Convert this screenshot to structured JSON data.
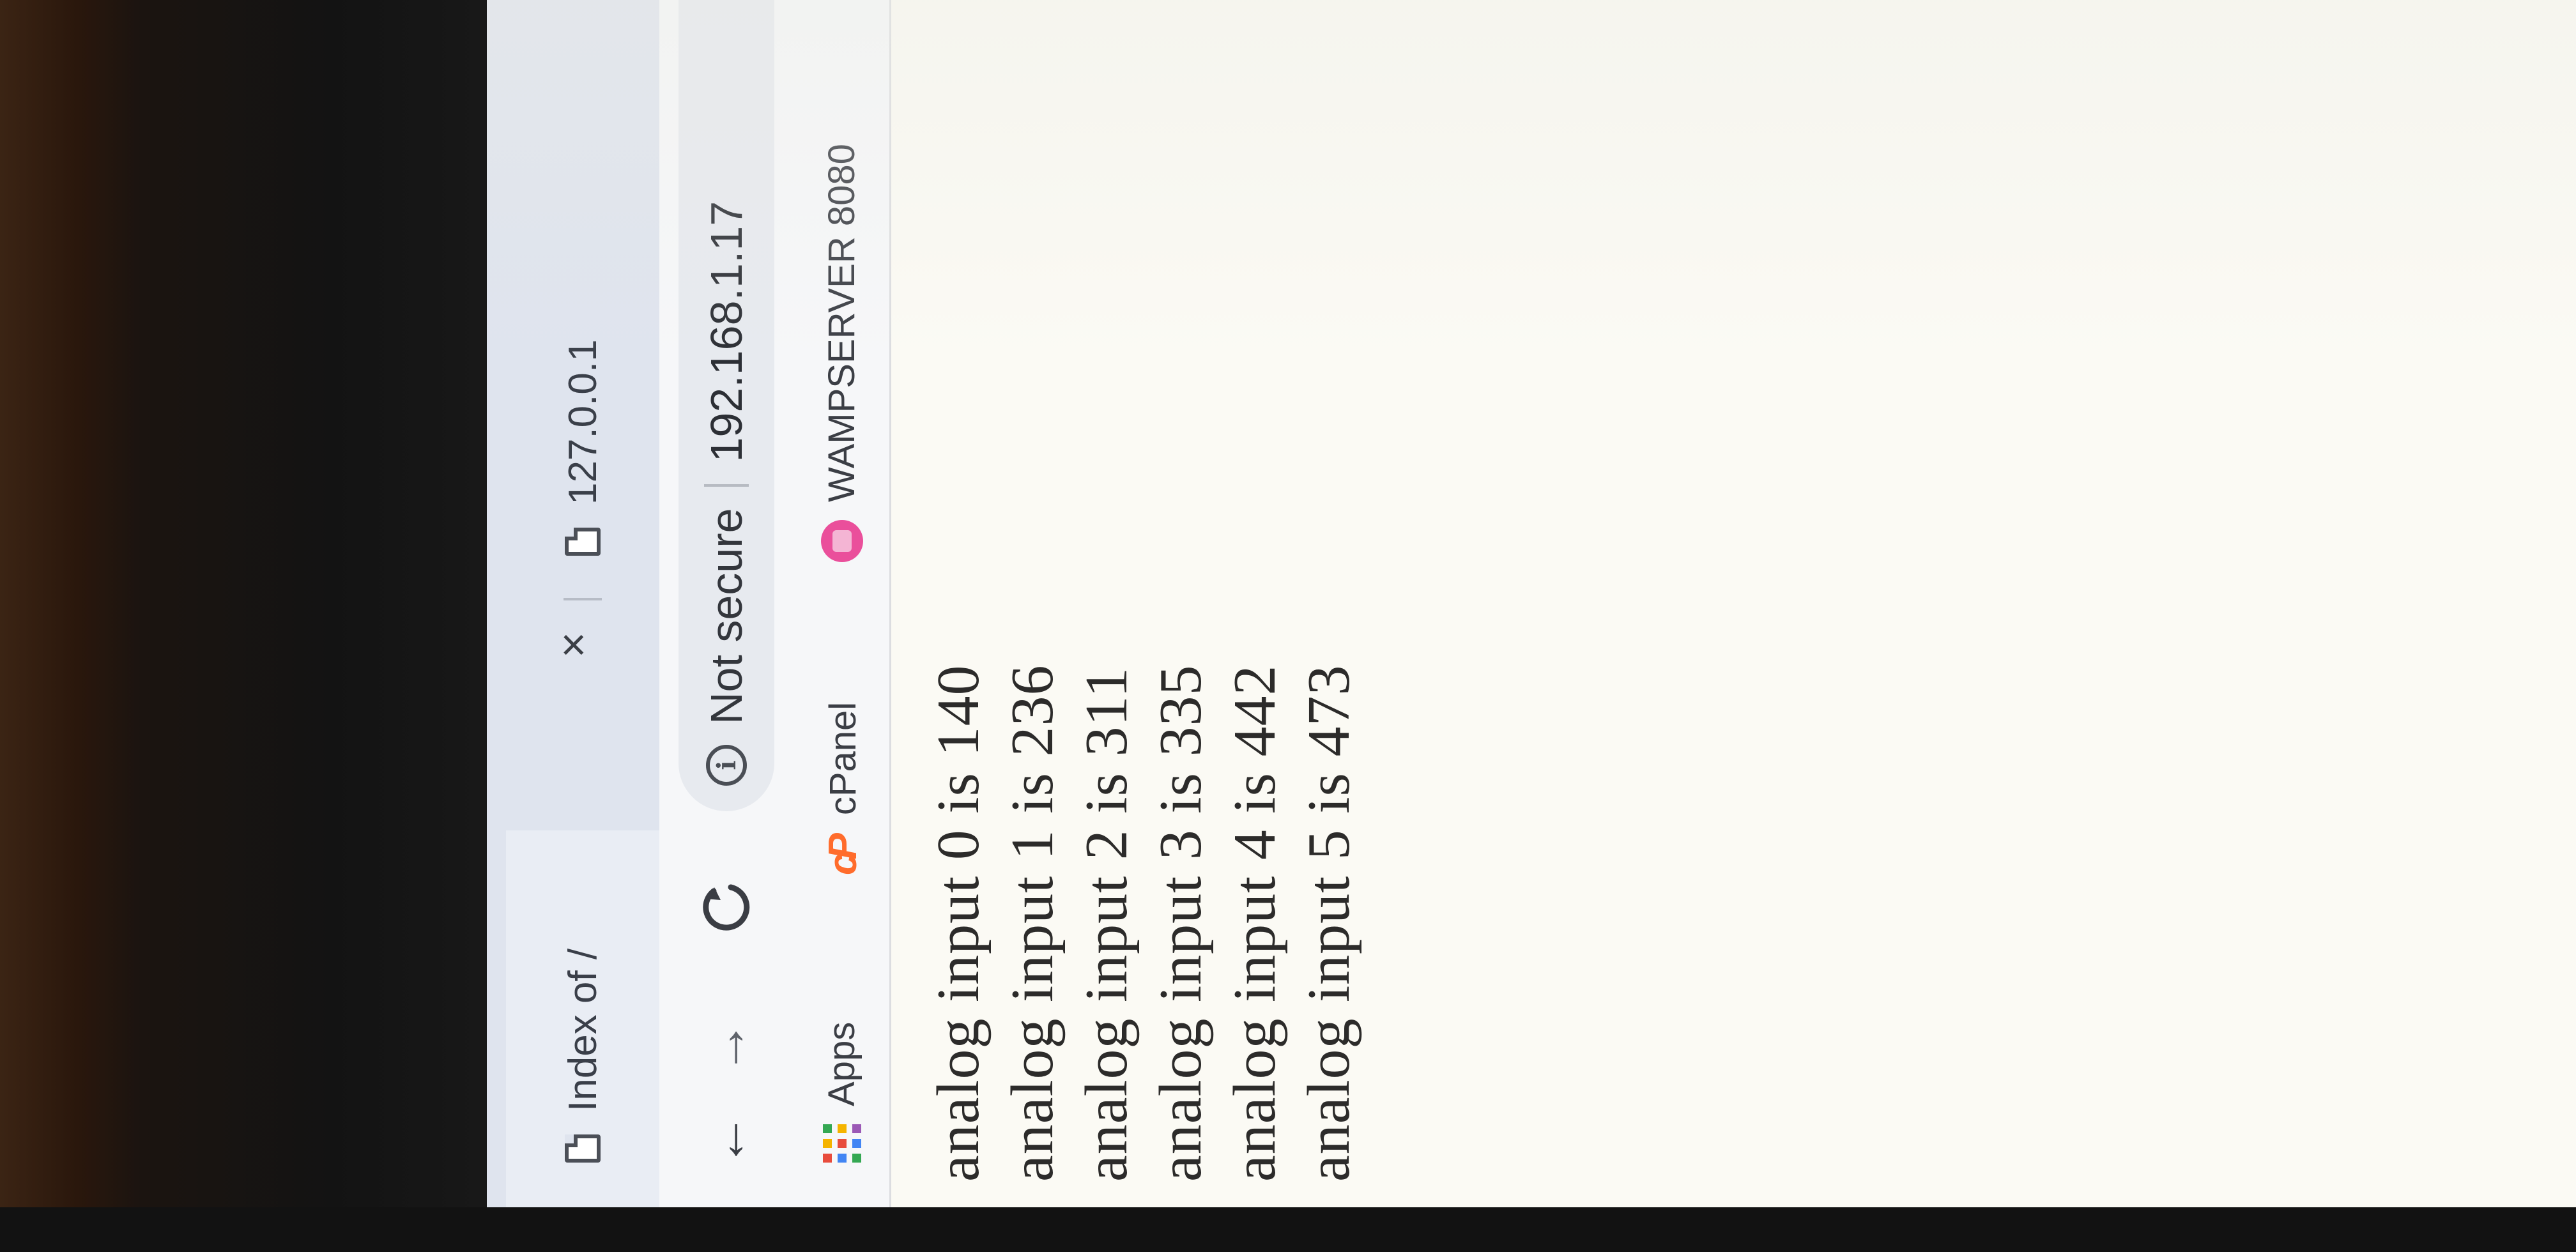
{
  "tabs": [
    {
      "title": "Index of /",
      "icon": "page-icon"
    },
    {
      "title": "127.0.0.1",
      "icon": "page-icon"
    }
  ],
  "tab_close_glyph": "×",
  "toolbar": {
    "back_glyph": "←",
    "forward_glyph": "→",
    "reload_glyph": "C",
    "security_label": "Not secure",
    "url": "192.168.1.17"
  },
  "bookmarks": {
    "items": [
      {
        "label": "Apps",
        "icon": "apps-grid-icon"
      },
      {
        "label": "cPanel",
        "icon": "cpanel-logo-icon"
      },
      {
        "label": "WAMPSERVER 8080",
        "icon": "wampserver-icon"
      }
    ],
    "cpanel_logo_text": "cP"
  },
  "content": {
    "lines": [
      "analog input 0 is 140",
      "analog input 1 is 236",
      "analog input 2 is 311",
      "analog input 3 is 335",
      "analog input 4 is 442",
      "analog input 5 is 473"
    ]
  },
  "colors": {
    "tabstrip": "#dfe4ee",
    "toolbar": "#f6f7f9",
    "page_background": "#fbfaf4",
    "cpanel_orange": "#ff6c2c",
    "wamp_pink": "#ea4f9b",
    "apps_grid": [
      "#e84c3d",
      "#f5b400",
      "#34a853",
      "#4285f4",
      "#e84c3d",
      "#f5b400",
      "#34a853",
      "#4285f4",
      "#9b59b6"
    ]
  }
}
